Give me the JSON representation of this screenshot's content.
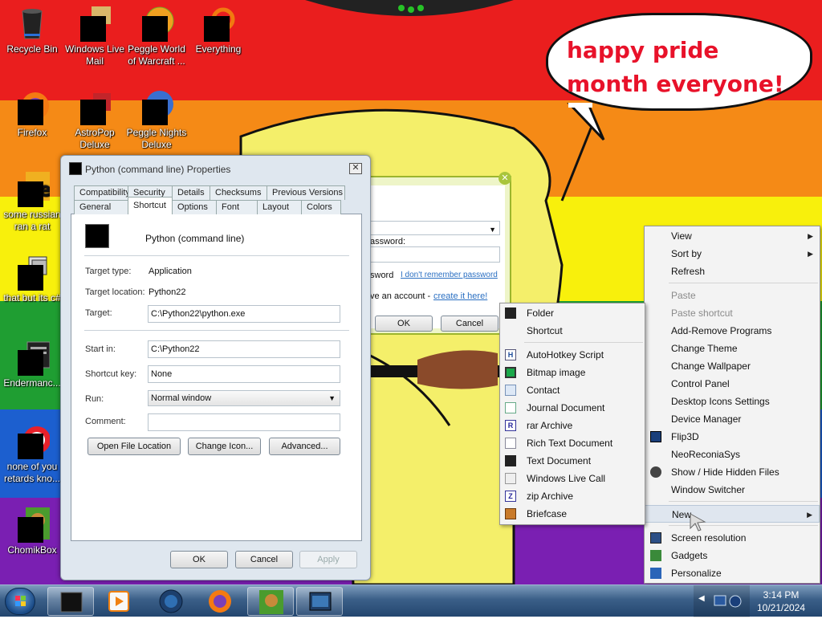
{
  "desktop": {
    "speech_text": "happy pride month everyone!",
    "colors": {
      "red": "#ea1e1e",
      "orange": "#f58a16",
      "yellow": "#f8f00c",
      "green": "#1f9e32",
      "blue": "#1c5fcf",
      "purple": "#7a1fb2",
      "face": "#f4ef6a"
    },
    "icons": [
      {
        "label": "Recycle Bin",
        "icon": "recycle-bin-icon"
      },
      {
        "label": "Windows Live Mail",
        "icon": "mail-icon"
      },
      {
        "label": "Peggle World of Warcraft ...",
        "icon": "peggle-wow-icon"
      },
      {
        "label": "Everything",
        "icon": "search-icon"
      },
      {
        "label": "Firefox",
        "icon": "firefox-icon"
      },
      {
        "label": "AstroPop Deluxe",
        "icon": "astropop-icon"
      },
      {
        "label": "Peggle Nights Deluxe",
        "icon": "peggle-nights-icon"
      },
      {
        "label": "some russian ran a rat",
        "icon": "app-icon"
      },
      {
        "label": "that but its c#",
        "icon": "shortcut-icon"
      },
      {
        "label": "Endermanc...",
        "icon": "app-icon"
      },
      {
        "label": "none of you retards kno...",
        "icon": "app-icon"
      },
      {
        "label": "ChomikBox",
        "icon": "chomikbox-icon"
      }
    ]
  },
  "properties": {
    "title": "Python (command line) Properties",
    "close_glyph": "✕",
    "tabs_row1": [
      "Compatibility",
      "Security",
      "Details",
      "Checksums",
      "Previous Versions"
    ],
    "tabs_row2": [
      "General",
      "Shortcut",
      "Options",
      "Font",
      "Layout",
      "Colors"
    ],
    "active_tab": "Shortcut",
    "name": "Python (command line)",
    "target_type_label": "Target type:",
    "target_type": "Application",
    "target_location_label": "Target location:",
    "target_location": "Python22",
    "target_label": "Target:",
    "target": "C:\\Python22\\python.exe",
    "start_in_label": "Start in:",
    "start_in": "C:\\Python22",
    "shortcut_key_label": "Shortcut key:",
    "shortcut_key": "None",
    "run_label": "Run:",
    "run": "Normal window",
    "comment_label": "Comment:",
    "comment": "",
    "open_location": "Open File Location",
    "change_icon": "Change Icon...",
    "advanced": "Advanced...",
    "ok": "OK",
    "cancel": "Cancel",
    "apply": "Apply"
  },
  "login": {
    "password_label": "assword:",
    "remember_label": "sword",
    "forgot_link": "I don't remember password",
    "account_text": "ve an account - ",
    "create_link": "create it here!",
    "ok": "OK",
    "cancel": "Cancel"
  },
  "context_menu": {
    "items": [
      {
        "label": "View",
        "arrow": "▶"
      },
      {
        "label": "Sort by",
        "arrow": "▶"
      },
      {
        "label": "Refresh"
      },
      {
        "label": "Paste",
        "disabled": true
      },
      {
        "label": "Paste shortcut",
        "disabled": true
      },
      {
        "label": "Add-Remove Programs"
      },
      {
        "label": "Change Theme"
      },
      {
        "label": "Change Wallpaper"
      },
      {
        "label": "Control Panel"
      },
      {
        "label": "Desktop Icons Settings"
      },
      {
        "label": "Device Manager"
      },
      {
        "label": "Flip3D"
      },
      {
        "label": "NeoReconiaSys"
      },
      {
        "label": "Show / Hide Hidden Files"
      },
      {
        "label": "Window Switcher"
      },
      {
        "label": "New",
        "arrow": "▶"
      },
      {
        "label": "Screen resolution"
      },
      {
        "label": "Gadgets"
      },
      {
        "label": "Personalize"
      }
    ]
  },
  "new_menu": {
    "items": [
      {
        "label": "Folder",
        "icon": "folder-icon"
      },
      {
        "label": "Shortcut",
        "icon": "shortcut-icon"
      },
      {
        "label": "AutoHotkey Script",
        "icon": "autohotkey-icon"
      },
      {
        "label": "Bitmap image",
        "icon": "bitmap-icon"
      },
      {
        "label": "Contact",
        "icon": "contact-icon"
      },
      {
        "label": "Journal Document",
        "icon": "journal-icon"
      },
      {
        "label": "rar Archive",
        "icon": "rar-icon"
      },
      {
        "label": "Rich Text Document",
        "icon": "rtf-icon"
      },
      {
        "label": "Text Document",
        "icon": "text-document-icon"
      },
      {
        "label": "Windows Live Call",
        "icon": "live-call-icon"
      },
      {
        "label": "zip Archive",
        "icon": "zip-icon"
      },
      {
        "label": "Briefcase",
        "icon": "briefcase-icon"
      }
    ]
  },
  "taskbar": {
    "time": "3:14 PM",
    "date": "10/21/2024",
    "tray_label": "◀",
    "buttons": [
      "terminal",
      "media-player",
      "app-globe",
      "firefox",
      "chomikbox",
      "window"
    ]
  }
}
